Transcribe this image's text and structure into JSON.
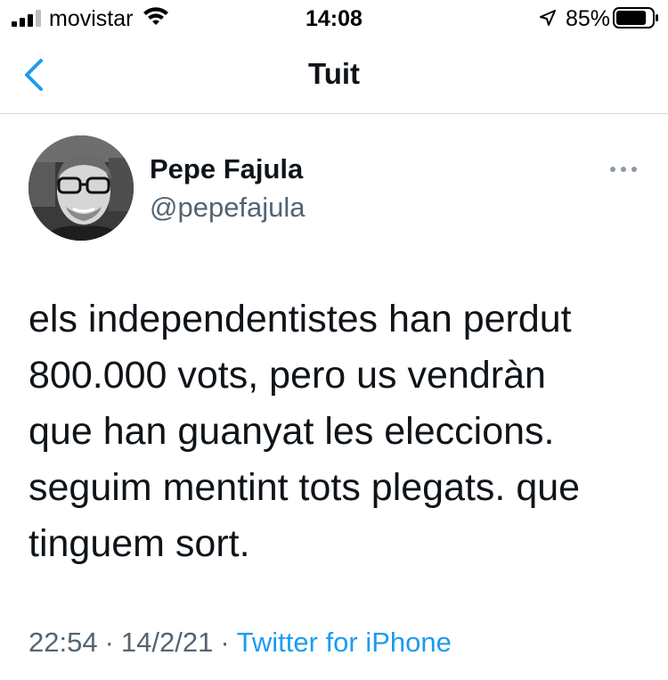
{
  "status_bar": {
    "carrier": "movistar",
    "time": "14:08",
    "battery_percent": "85%",
    "battery_level": 0.85,
    "icons": [
      "signal-icon",
      "wifi-icon",
      "location-arrow-icon",
      "battery-icon"
    ]
  },
  "nav": {
    "title": "Tuit",
    "back_icon": "chevron-left-icon",
    "accent_color": "#1d9bf0"
  },
  "tweet": {
    "display_name": "Pepe Fajula",
    "handle": "@pepefajula",
    "more_icon": "more-horizontal-icon",
    "lines": [
      "els independentistes han perdut",
      "800.000 vots, pero us vendràn",
      "que han guanyat les eleccions.",
      "seguim mentint tots plegats. que",
      "tinguem sort."
    ],
    "time": "22:54",
    "separator": "·",
    "date": "14/2/21",
    "source": "Twitter for iPhone"
  },
  "colors": {
    "text": "#0f1419",
    "secondary": "#536471",
    "link": "#1d9bf0",
    "divider": "#d5d9dc"
  }
}
